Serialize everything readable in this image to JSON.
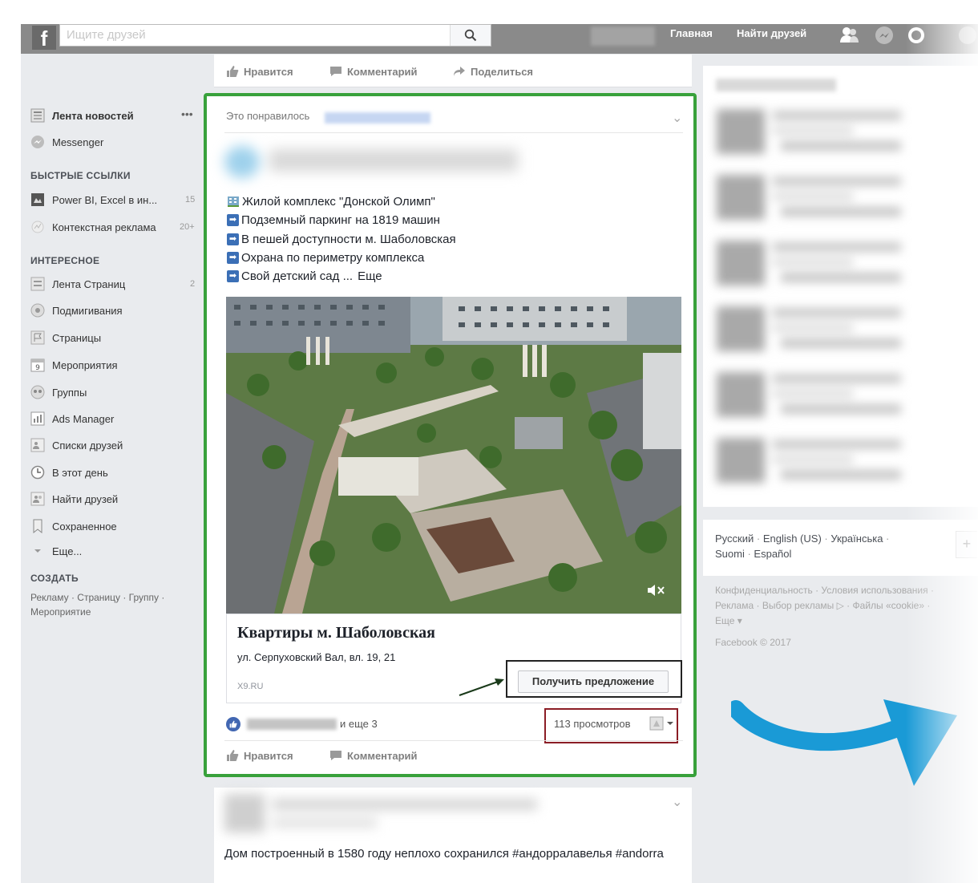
{
  "search": {
    "placeholder": "Ищите друзей"
  },
  "topnav": {
    "home": "Главная",
    "find_friends": "Найти друзей"
  },
  "sidebar": {
    "main_items": [
      {
        "label": "Лента новостей",
        "icon": "news-feed-icon"
      },
      {
        "label": "Messenger",
        "icon": "messenger-icon"
      }
    ],
    "quick_links_title": "БЫСТРЫЕ ССЫЛКИ",
    "quick_links": [
      {
        "label": "Power BI, Excel в ин...",
        "count": "15"
      },
      {
        "label": "Контекстная реклама",
        "count": "20+"
      }
    ],
    "interesting_title": "ИНТЕРЕСНОЕ",
    "interesting": [
      {
        "label": "Лента Страниц",
        "count": "2"
      },
      {
        "label": "Подмигивания"
      },
      {
        "label": "Страницы"
      },
      {
        "label": "Мероприятия",
        "icon_text": "9"
      },
      {
        "label": "Группы"
      },
      {
        "label": "Ads Manager"
      },
      {
        "label": "Списки друзей"
      },
      {
        "label": "В этот день"
      },
      {
        "label": "Найти друзей"
      },
      {
        "label": "Сохраненное"
      },
      {
        "label": "Еще..."
      }
    ],
    "create_title": "СОЗДАТЬ",
    "create_links": [
      "Рекламу",
      "Страницу",
      "Группу",
      "Мероприятие"
    ]
  },
  "actions": {
    "like": "Нравится",
    "comment": "Комментарий",
    "share": "Поделиться"
  },
  "ad_post": {
    "liked_by": "Это понравилось",
    "lines": [
      "Жилой комплекс \"Донской Олимп\"",
      "Подземный паркинг на 1819 машин",
      "В пешей доступности м. Шаболовская",
      "Охрана по периметру комплекса",
      "Свой детский сад ..."
    ],
    "more": "Еще",
    "link_title": "Квартиры м. Шаболовская",
    "link_address": "ул. Серпуховский Вал, вл. 19, 21",
    "link_domain": "X9.RU",
    "cta": "Получить предложение",
    "reactions_more": "и еще 3",
    "views": "113 просмотров"
  },
  "next_post": {
    "text": "Дом построенный в 1580 году неплохо сохранился #андорралавелья #andorra"
  },
  "footer": {
    "languages": [
      "Русский",
      "English (US)",
      "Українська",
      "Suomi",
      "Español"
    ],
    "legal": [
      "Конфиденциальность",
      "Условия использования",
      "Реклама",
      "Выбор рекламы",
      "Файлы «cookie»",
      "Еще"
    ],
    "copyright": "Facebook © 2017"
  },
  "colors": {
    "highlight_green": "#38a13b",
    "highlight_red": "#8b1d25",
    "arrow_blue": "#1a9ad6",
    "fb_blue": "#4267b2"
  }
}
